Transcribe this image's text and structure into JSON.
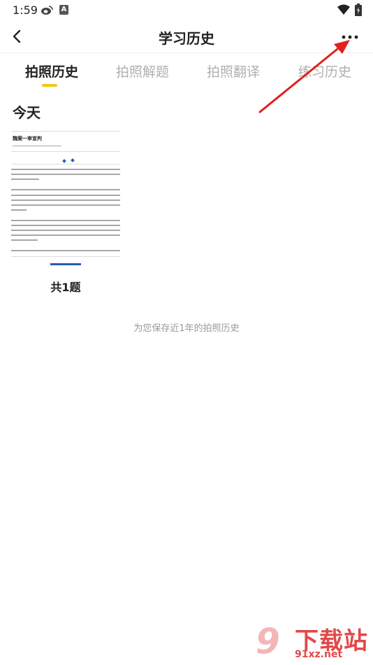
{
  "status_bar": {
    "time": "1:59",
    "a_label": "A"
  },
  "header": {
    "title": "学习历史"
  },
  "tabs": [
    {
      "label": "拍照历史",
      "active": true
    },
    {
      "label": "拍照解题",
      "active": false
    },
    {
      "label": "拍照翻译",
      "active": false
    },
    {
      "label": "练习历史",
      "active": false
    }
  ],
  "section": {
    "heading": "今天"
  },
  "card": {
    "thumbnail_title": "魏案一审宣判",
    "count": "共1题"
  },
  "footer_note": "为您保存近1年的拍照历史",
  "watermark": {
    "number": "9",
    "text": "下载站",
    "url": "91xz.net"
  },
  "colors": {
    "accent": "#f5c518",
    "arrow": "#e02020",
    "tab_inactive": "#b0b0b0"
  }
}
